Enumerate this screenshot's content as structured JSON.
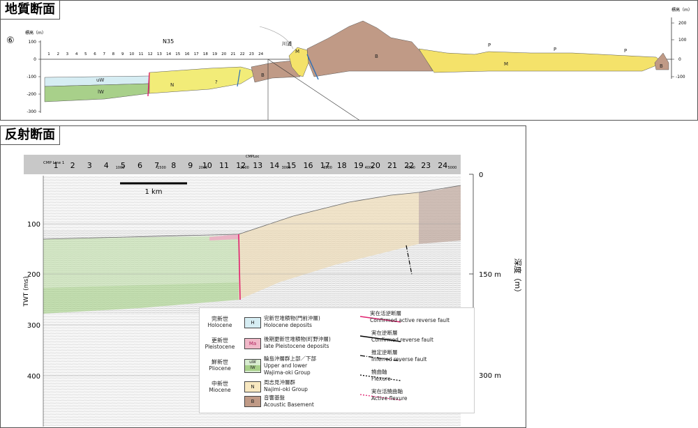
{
  "geology_section": {
    "title": "地質断面",
    "section_number": "⑥",
    "elev_label_left": "標高（m）",
    "elev_label_right": "標高（m）",
    "left_ticks": [
      "100",
      "0",
      "-100",
      "-200",
      "-300"
    ],
    "right_ticks": [
      "200",
      "100",
      "0",
      "-100"
    ],
    "station_numbers": [
      "1",
      "2",
      "3",
      "4",
      "5",
      "6",
      "7",
      "8",
      "9",
      "10",
      "11",
      "12",
      "13",
      "14",
      "15",
      "16",
      "17",
      "18",
      "19",
      "20",
      "21",
      "22",
      "23",
      "24"
    ],
    "line_label": "N35",
    "place_label": "川浦",
    "unit_labels": {
      "uw": "uW",
      "lw": "lW",
      "n": "N",
      "q": "?",
      "b1": "B",
      "m1": "M",
      "b2": "B",
      "p1": "P",
      "p2": "P",
      "p3": "P",
      "m2": "M",
      "b3": "B"
    },
    "colors": {
      "holocene": "#cfe8f0",
      "pleistocene": "#f0b8c8",
      "uw": "#d8ecd0",
      "lw": "#a8d08a",
      "n": "#f2ec78",
      "b": "#c09a86",
      "m": "#f4e26a"
    }
  },
  "reflection_section": {
    "title": "反射断面",
    "cmp_line_label": "CMP Line 1",
    "cmp_loc_label": "CMPLoc",
    "cmp_ticks": [
      "1000",
      "1500",
      "2000",
      "2500",
      "3000",
      "3500",
      "4000",
      "4500",
      "5000"
    ],
    "station_numbers": [
      "1",
      "2",
      "3",
      "4",
      "5",
      "6",
      "7",
      "8",
      "9",
      "10",
      "11",
      "12",
      "13",
      "14",
      "15",
      "16",
      "17",
      "18",
      "19",
      "20",
      "21",
      "22",
      "23",
      "24"
    ],
    "scale_bar_label": "1 km",
    "twt_axis_label": "TWT (ms)",
    "twt_ticks": [
      "100",
      "200",
      "300",
      "400"
    ],
    "depth_axis_label": "深度（m）",
    "depth_ticks": [
      "0",
      "150 m",
      "300 m"
    ]
  },
  "legend": {
    "eras": [
      {
        "jp": "完新世",
        "en": "Holocene"
      },
      {
        "jp": "更新世",
        "en": "Pleistocene"
      },
      {
        "jp": "鮮新世",
        "en": "Pliocene"
      },
      {
        "jp": "中新世",
        "en": "Miocene"
      }
    ],
    "units": [
      {
        "code": "H",
        "jp": "完新世堆積物(門前沖層)",
        "en": "Holocene deposits"
      },
      {
        "code": "Ma",
        "jp": "後期更新世堆積物(町野沖層)",
        "en": "late Pleistocene deposits"
      },
      {
        "code_top": "uW",
        "code_bottom": "lW",
        "jp": "輪島沖層群上部／下部",
        "en": "Upper and lower",
        "en2": "Wajima-oki Group"
      },
      {
        "code": "N",
        "jp": "周志見沖層群",
        "en": "Najimi-oki Group"
      },
      {
        "code": "B",
        "jp": "音響基盤",
        "en": "Acoustic Basement"
      }
    ],
    "faults": [
      {
        "jp": "実在活逆断層",
        "en": "Confirmed active reverse fault",
        "color": "#e0206e"
      },
      {
        "jp": "実在逆断層",
        "en": "Confirmed reverse fault",
        "color": "#000000"
      },
      {
        "jp": "推定逆断層",
        "en": "Inferred reverse fault",
        "color": "#000000"
      },
      {
        "jp": "撓曲軸",
        "en": "Flexure",
        "color": "#000000"
      },
      {
        "jp": "実在活撓曲軸",
        "en": "Active flexure",
        "color": "#e0206e"
      }
    ]
  }
}
